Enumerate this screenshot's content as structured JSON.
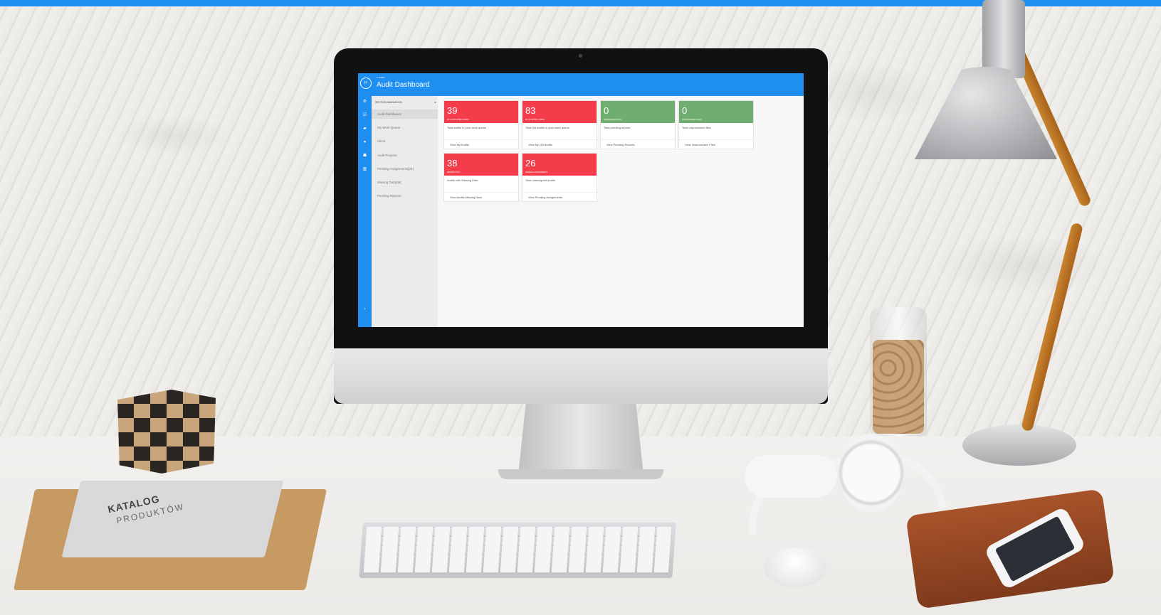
{
  "colors": {
    "accent": "#1e8ef0",
    "alert_red": "#f43c4b",
    "ok_green": "#6fae70"
  },
  "app": {
    "logo": "H",
    "breadcrumb": "H AUDIT",
    "title": "Audit Dashboard"
  },
  "iconbar": {
    "icons": [
      "gear-icon",
      "check-square-icon",
      "folder-icon",
      "globe-icon",
      "user-icon",
      "bank-icon",
      "chevron-right-icon"
    ]
  },
  "nav": {
    "section_label": "SECTION NAVIGATION",
    "collapse_glyph": "◂",
    "items": [
      {
        "label": "Audit Dashboard",
        "active": true
      },
      {
        "label": "My Work Queue",
        "active": false
      },
      {
        "label": "Client",
        "active": false
      },
      {
        "label": "Audit Projects",
        "active": false
      },
      {
        "label": "Pending Assignments[26]",
        "active": false
      },
      {
        "label": "Missing Data[38]",
        "active": false
      },
      {
        "label": "Pending Reports",
        "active": false
      }
    ]
  },
  "cards": [
    {
      "number": "39",
      "label": "MY AUDIT WORK QUEUE",
      "description": "Total audits in your work queue",
      "link": "View My Audits",
      "status": "red"
    },
    {
      "number": "83",
      "label": "MY QA WORK QUEUE",
      "description": "Total QA audits in your work queue",
      "link": "View My QA Audits",
      "status": "red"
    },
    {
      "number": "0",
      "label": "PENDING REPORTS",
      "description": "Total pending reports",
      "link": "View Pending Reports",
      "status": "green"
    },
    {
      "number": "0",
      "label": "UNPROCESSED FILES",
      "description": "Total unprocessed files",
      "link": "View Unprocessed Files",
      "status": "green"
    },
    {
      "number": "38",
      "label": "MISSING DATA",
      "description": "Audits with Missing Data",
      "link": "View Audits Missing Data",
      "status": "red"
    },
    {
      "number": "26",
      "label": "PENDING ASSIGNMENTS",
      "description": "Total unassigned audits",
      "link": "View Pending Assignments",
      "status": "red"
    }
  ],
  "props": {
    "catalog_title": "KATALOG",
    "catalog_subtitle": "PRODUKTÓW"
  }
}
